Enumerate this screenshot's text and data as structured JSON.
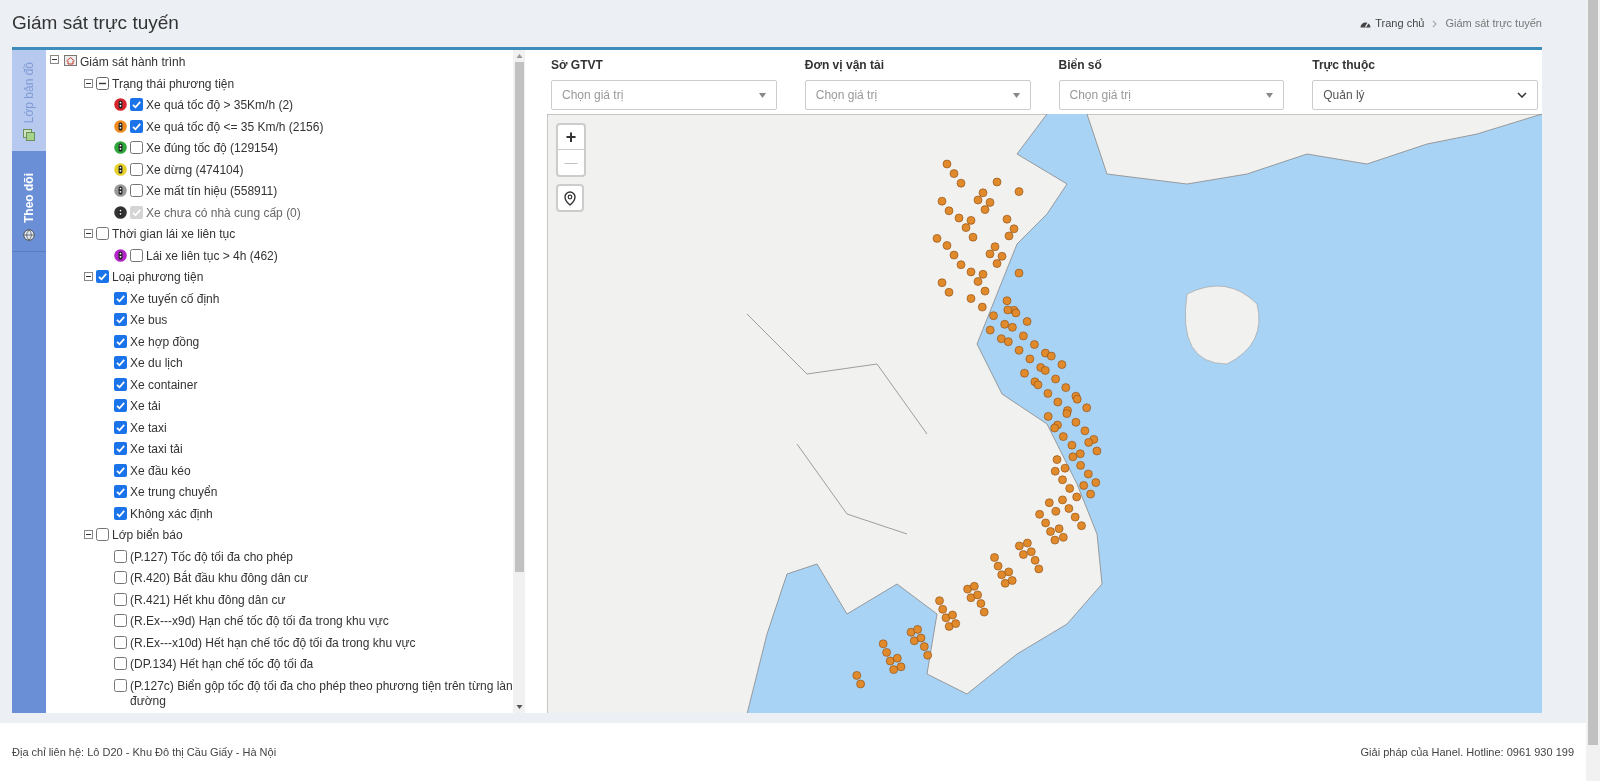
{
  "page_title": "Giám sát trực tuyến",
  "breadcrumb": [
    {
      "label": "Trang chủ",
      "kind": "home"
    },
    {
      "label": "Giám sát trực tuyến",
      "kind": "current"
    }
  ],
  "side_tabs": [
    {
      "label": "Lớp bản đồ",
      "selected": false
    },
    {
      "label": "Theo dõi",
      "selected": true
    }
  ],
  "tree": {
    "label": "Giám sát hành trình",
    "kind": "root",
    "expanded": true,
    "children": [
      {
        "label": "Trạng thái phương tiện",
        "kind": "group",
        "expanded": true,
        "checked": false,
        "indeterminate": true,
        "children": [
          {
            "label": "Xe quá tốc độ > 35Km/h (2)",
            "kind": "item",
            "color": "#d9262c",
            "checked": true,
            "disabled": false
          },
          {
            "label": "Xe quá tốc độ <= 35 Km/h (2156)",
            "kind": "item",
            "color": "#f08a1c",
            "checked": true,
            "disabled": false
          },
          {
            "label": "Xe đúng tốc độ (129154)",
            "kind": "item",
            "color": "#2ea83a",
            "checked": false,
            "disabled": false
          },
          {
            "label": "Xe dừng (474104)",
            "kind": "item",
            "color": "#e6d02a",
            "checked": false,
            "disabled": false
          },
          {
            "label": "Xe mất tín hiệu (558911)",
            "kind": "item",
            "color": "#9a9a9a",
            "checked": false,
            "disabled": false
          },
          {
            "label": "Xe chưa có nhà cung cấp (0)",
            "kind": "item",
            "color": "#333333",
            "checked": true,
            "disabled": true
          }
        ]
      },
      {
        "label": "Thời gian lái xe liên tục",
        "kind": "group",
        "expanded": true,
        "checked": false,
        "indeterminate": false,
        "children": [
          {
            "label": "Lái xe liên tục > 4h (462)",
            "kind": "item",
            "color": "#b226c8",
            "checked": false,
            "disabled": false
          }
        ]
      },
      {
        "label": "Loại phương tiện",
        "kind": "group",
        "expanded": true,
        "checked": true,
        "indeterminate": false,
        "children": [
          {
            "label": "Xe tuyến cố định",
            "kind": "item",
            "checked": true,
            "disabled": false
          },
          {
            "label": "Xe bus",
            "kind": "item",
            "checked": true,
            "disabled": false
          },
          {
            "label": "Xe hợp đồng",
            "kind": "item",
            "checked": true,
            "disabled": false
          },
          {
            "label": "Xe du lịch",
            "kind": "item",
            "checked": true,
            "disabled": false
          },
          {
            "label": "Xe container",
            "kind": "item",
            "checked": true,
            "disabled": false
          },
          {
            "label": "Xe tải",
            "kind": "item",
            "checked": true,
            "disabled": false
          },
          {
            "label": "Xe taxi",
            "kind": "item",
            "checked": true,
            "disabled": false
          },
          {
            "label": "Xe taxi tải",
            "kind": "item",
            "checked": true,
            "disabled": false
          },
          {
            "label": "Xe đầu kéo",
            "kind": "item",
            "checked": true,
            "disabled": false
          },
          {
            "label": "Xe trung chuyển",
            "kind": "item",
            "checked": true,
            "disabled": false
          },
          {
            "label": "Không xác định",
            "kind": "item",
            "checked": true,
            "disabled": false
          }
        ]
      },
      {
        "label": "Lớp biển báo",
        "kind": "group",
        "expanded": true,
        "checked": false,
        "indeterminate": false,
        "children": [
          {
            "label": "(P.127) Tốc độ tối đa cho phép",
            "kind": "item",
            "checked": false,
            "disabled": false
          },
          {
            "label": "(R.420) Bắt đầu khu đông dân cư",
            "kind": "item",
            "checked": false,
            "disabled": false
          },
          {
            "label": "(R.421) Hết khu đông dân cư",
            "kind": "item",
            "checked": false,
            "disabled": false
          },
          {
            "label": "(R.Ex---x9d) Hạn chế tốc độ tối đa trong khu vực",
            "kind": "item",
            "checked": false,
            "disabled": false
          },
          {
            "label": "(R.Ex---x10d) Hết hạn chế tốc độ tối đa trong khu vực",
            "kind": "item",
            "checked": false,
            "disabled": false
          },
          {
            "label": "(DP.134) Hết hạn chế tốc độ tối đa",
            "kind": "item",
            "checked": false,
            "disabled": false
          },
          {
            "label": "(P.127c) Biển gộp tốc độ tối đa cho phép theo phương tiện trên từng làn đường",
            "kind": "item",
            "checked": false,
            "disabled": false
          }
        ]
      }
    ]
  },
  "filters": [
    {
      "label": "Sở GTVT",
      "kind": "combo",
      "placeholder": "Chọn giá trị"
    },
    {
      "label": "Đơn vị vận tải",
      "kind": "combo",
      "placeholder": "Chọn giá trị"
    },
    {
      "label": "Biển số",
      "kind": "combo",
      "placeholder": "Chọn giá trị"
    },
    {
      "label": "Trực thuộc",
      "kind": "select",
      "value": "Quản lý"
    }
  ],
  "map": {
    "zoom_in": "+",
    "zoom_out": "—"
  },
  "footer": {
    "address": "Địa chỉ liên hệ: Lô D20 - Khu Đô thị Cầu Giấy - Hà Nội",
    "credit": "Giải pháp của Hanel. Hotline: 0961 930 199"
  }
}
